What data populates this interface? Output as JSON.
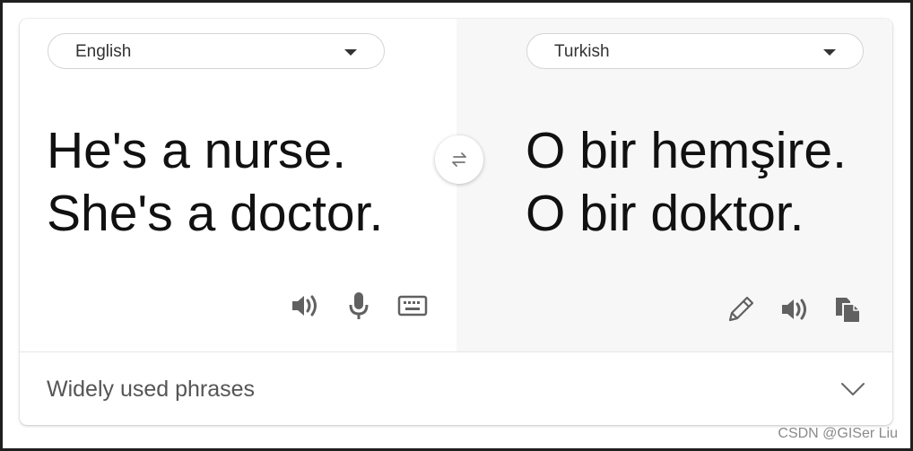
{
  "source": {
    "language": "English",
    "text_lines": [
      "He's a nurse.",
      "She's a doctor."
    ]
  },
  "target": {
    "language": "Turkish",
    "text_lines": [
      "O bir hemşire.",
      "O bir doktor."
    ]
  },
  "source_tools": [
    "speaker-icon",
    "microphone-icon",
    "keyboard-icon"
  ],
  "target_tools": [
    "pencil-icon",
    "speaker-icon",
    "copy-icon"
  ],
  "swap_icon": "swap-arrows-icon",
  "phrases": {
    "label": "Widely used phrases",
    "icon": "chevron-down-icon"
  },
  "watermark": "CSDN @GISer Liu",
  "colors": {
    "target_pane_bg": "#f7f7f7",
    "icon_gray": "#616161",
    "text": "#111111"
  }
}
